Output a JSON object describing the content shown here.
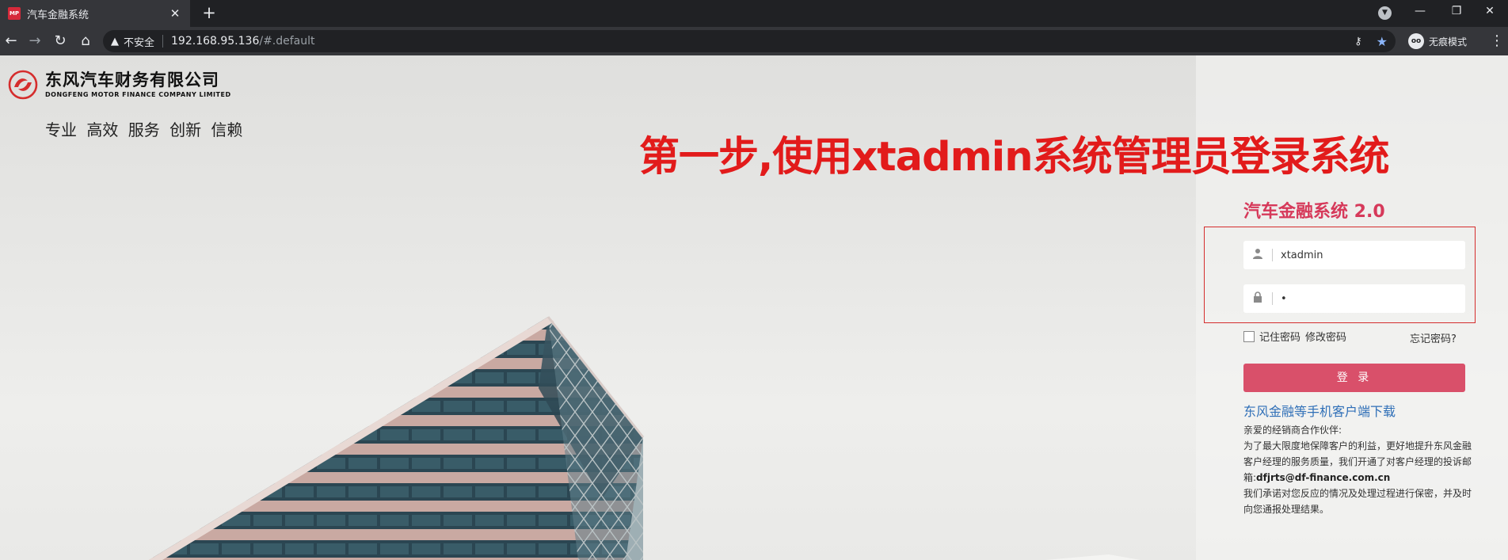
{
  "browser": {
    "tab_title": "汽车金融系统",
    "favicon_text": "MP",
    "close_tab_glyph": "✕",
    "new_tab_glyph": "+",
    "window_controls": {
      "minimize": "—",
      "restore": "❐",
      "close": "✕"
    },
    "security_label": "不安全",
    "url_host": "192.168.95.136",
    "url_path": "/#.default",
    "incognito_label": "无痕模式",
    "incognito_badge": "oo"
  },
  "brand": {
    "name_cn": "东风汽车财务有限公司",
    "name_en": "DONGFENG MOTOR FINANCE COMPANY LIMITED",
    "slogan": "专业 高效 服务 创新 信赖",
    "accent_color": "#d9506a",
    "logo_color": "#d52d2d"
  },
  "annotation": {
    "text": "第一步,使用xtadmin系统管理员登录系统",
    "color": "#e21b1b"
  },
  "login": {
    "system_title": "汽车金融系统 2.0",
    "username_value": "xtadmin",
    "password_value": "•",
    "username_icon": "user-icon",
    "password_icon": "lock-icon",
    "remember_label": "记住密码",
    "change_password_label": "修改密码",
    "forgot_label": "忘记密码?",
    "login_button_label": "登 录",
    "download_link": "东风金融等手机客户端下载"
  },
  "notice": {
    "greeting": "亲爱的经销商合作伙伴:",
    "line1": "为了最大限度地保障客户的利益，更好地提升东风金融客户经理的服务质量，我们开通了对客户经理的投诉邮箱:",
    "email": "dfjrts@df-finance.com.cn",
    "line2": "我们承诺对您反应的情况及处理过程进行保密，并及时向您通报处理结果。"
  }
}
